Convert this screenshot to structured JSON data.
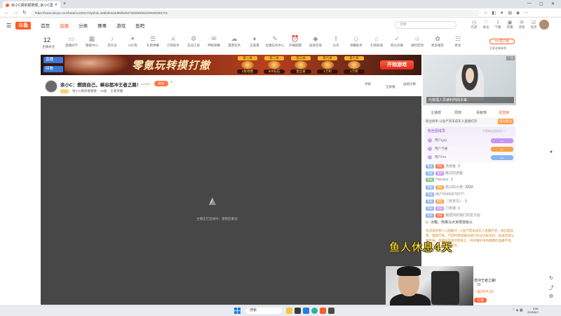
{
  "browser": {
    "tab_title": "余小C真的很随便_余小C直播间",
    "url": "https://www.douyu.com/beta/11209107dyshid=166b0b4a4d95fbd4676eb084b6d1b9e00091701",
    "window_controls": [
      "—",
      "▢",
      "✕"
    ],
    "new_tab": "+",
    "close_tab": "✕"
  },
  "header": {
    "logo": "斗鱼",
    "nav": [
      "首页",
      "直播",
      "分类",
      "赛事",
      "游戏",
      "鱼吧"
    ],
    "search_placeholder": "搜索",
    "icons": [
      {
        "icon": "clock-icon",
        "label": "历史"
      },
      {
        "icon": "follow-icon",
        "label": "关注"
      },
      {
        "icon": "download-icon",
        "label": "下载"
      },
      {
        "icon": "broadcast-icon",
        "label": "开播"
      },
      {
        "icon": "message-icon",
        "label": "消息"
      },
      {
        "icon": "task-icon",
        "label": "任务"
      }
    ]
  },
  "categories": {
    "follow_count": "12",
    "follow_label": "主播关注",
    "items": [
      "直播间卡",
      "数据中心",
      "音乐台",
      "AI礼物",
      "礼物弹幕",
      "刀塔助手",
      "互动工具",
      "神秘弹幕",
      "漫游任务",
      "正能量",
      "主播任务中心",
      "开播提醒",
      "鱼翅充值",
      "分享",
      "弹幕助手",
      "礼物商城",
      "积分兑换",
      "福利签到",
      "更多推荐",
      "更多"
    ],
    "pc_client": "PC客户端",
    "pc_sub": "立享全新体验"
  },
  "banner": {
    "live_btn": "直播",
    "replay_btn": "回看",
    "headline": "零氪玩转摸打撤",
    "prizes": [
      {
        "tag": "第一关",
        "desc": "2张地图"
      },
      {
        "tag": "第二关",
        "desc": "500钻石"
      },
      {
        "tag": "第三关",
        "desc": "金丝雀"
      },
      {
        "tag": "第六关",
        "desc": "1万积"
      },
      {
        "tag": "第七关",
        "desc": "1万积"
      }
    ],
    "cta": "开始游戏"
  },
  "room": {
    "title": "余小C：燃烧自己，峡谷怒冲王者之路！",
    "room_id": "1004857",
    "follow": "关注",
    "plus": "+",
    "anchor_name": "余小C真的很随便",
    "tags": [
      "12级",
      "王者荣耀"
    ],
    "report": "举报",
    "screen": "全屏播",
    "mode": "画质切换"
  },
  "video": {
    "loading_text": "主播正在连线中，请稍后重试"
  },
  "ad": {
    "label": "广告",
    "caption": "元璧理人员被判刑前夕来"
  },
  "sidebar": {
    "tabs": [
      "主播榜",
      "周榜",
      "贡献榜",
      "贵宾席",
      "粉丝团"
    ],
    "active_tab_index": 4,
    "rank_line": "粉丝榜单    斗鱼严禁未成年人直播打赏",
    "rank_btn": "成为粉丝",
    "fans_title": "粉丝团成员",
    "fans_more": "不是粉丝团成员? >",
    "fans": [
      {
        "name": "用户(ya)",
        "tag": "Lv.",
        "tag_color": "#c497f0"
      },
      {
        "name": "用户卡通",
        "tag": "Lv.",
        "tag_color": "#f2a24a"
      },
      {
        "name": "用户Pre",
        "tag": "Lv.",
        "tag_color": "#8ab4f0"
      }
    ],
    "chat": [
      {
        "lv": "等级",
        "badge": "超级",
        "user": "流浪鱼:",
        "text": "1",
        "lvcolor": "#8ab4f0",
        "bcolor": "#ff6a3a"
      },
      {
        "lv": "等级",
        "badge": "铁粉",
        "user": "路过的游客:",
        "text": "",
        "lvcolor": "#8ab4f0",
        "bcolor": "#c497f0"
      },
      {
        "lv": "等级",
        "badge": "",
        "user": "Hakutsu:",
        "text": "1",
        "lvcolor": "#7ec48a",
        "bcolor": ""
      },
      {
        "lv": "等级",
        "badge": "超级",
        "user": "高冷的大佬:",
        "text": "2222",
        "lvcolor": "#8ab4f0",
        "bcolor": "#f2a24a"
      },
      {
        "lv": "等级",
        "badge": "",
        "user": "用户554565782??:",
        "text": "",
        "lvcolor": "#8ab4f0",
        "bcolor": ""
      },
      {
        "lv": "等级",
        "badge": "超级",
        "user": "（安安鸟）:",
        "text": "1",
        "lvcolor": "#8ab4f0",
        "bcolor": "#f2a24a"
      },
      {
        "lv": "等级",
        "badge": "超级",
        "user": "刀米装:",
        "text": "1",
        "lvcolor": "#8ab4f0",
        "bcolor": "#c497f0"
      },
      {
        "lv": "等级",
        "badge": "超级",
        "user": "我把你的我们的爱又给",
        "text": "",
        "lvcolor": "#8ab4f0",
        "bcolor": "#ff6a3a"
      },
      {
        "lv": "",
        "badge": "",
        "user": "ly:",
        "text": "冰箱，阿离马大米燃烧给么",
        "lvcolor": "",
        "bcolor": ""
      }
    ],
    "notice": "欢迎来到余小C直播间！斗鱼严禁未成年人直播打赏，请合理消费，理性打赏。严禁利用直播间进行违法违规活动，如发现请立即举报。直播间内请文明发言，共同维护绿色健康的直播环境，谢谢大家的支持与配合。",
    "danmu_count": "00",
    "gift": "礼物",
    "side_text1": "怒冲王者之路!",
    "side_text2": "一起冲冲 (3)"
  },
  "overlay": {
    "text": "鱼人休息4天"
  },
  "taskbar": {
    "search": "搜索",
    "time": "9:56",
    "date": "2025/5/2"
  }
}
